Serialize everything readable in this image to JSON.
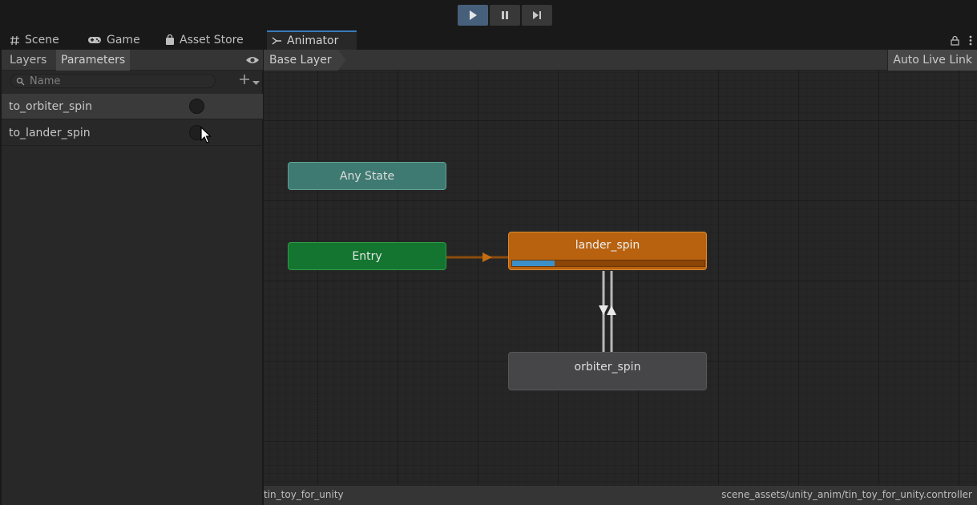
{
  "play_controls": {
    "play": "play-icon",
    "pause": "pause-icon",
    "step": "step-icon"
  },
  "tabs": [
    {
      "label": "Scene",
      "icon": "grid-hash-icon"
    },
    {
      "label": "Game",
      "icon": "gamepad-icon"
    },
    {
      "label": "Asset Store",
      "icon": "shopping-bag-icon"
    },
    {
      "label": "Animator",
      "icon": "animator-icon",
      "active": true
    }
  ],
  "left_panel": {
    "subtabs": [
      "Layers",
      "Parameters"
    ],
    "active_subtab": "Parameters",
    "search_placeholder": "Name",
    "parameters": [
      {
        "name": "to_orbiter_spin",
        "type": "trigger",
        "selected": true
      },
      {
        "name": "to_lander_spin",
        "type": "trigger",
        "selected": false
      }
    ]
  },
  "animator": {
    "breadcrumb": "Base Layer",
    "live_link_button": "Auto Live Link",
    "states": {
      "any_state": "Any State",
      "entry": "Entry",
      "lander_spin": "lander_spin",
      "orbiter_spin": "orbiter_spin"
    },
    "lander_progress": 0.22,
    "status_left": "tin_toy_for_unity",
    "status_right": "scene_assets/unity_anim/tin_toy_for_unity.controller"
  },
  "colors": {
    "any_state": "#3f7a72",
    "entry": "#137530",
    "default_state": "#b8620f",
    "state": "#464649",
    "progress": "#3d90c7",
    "play_active": "#46607c"
  }
}
